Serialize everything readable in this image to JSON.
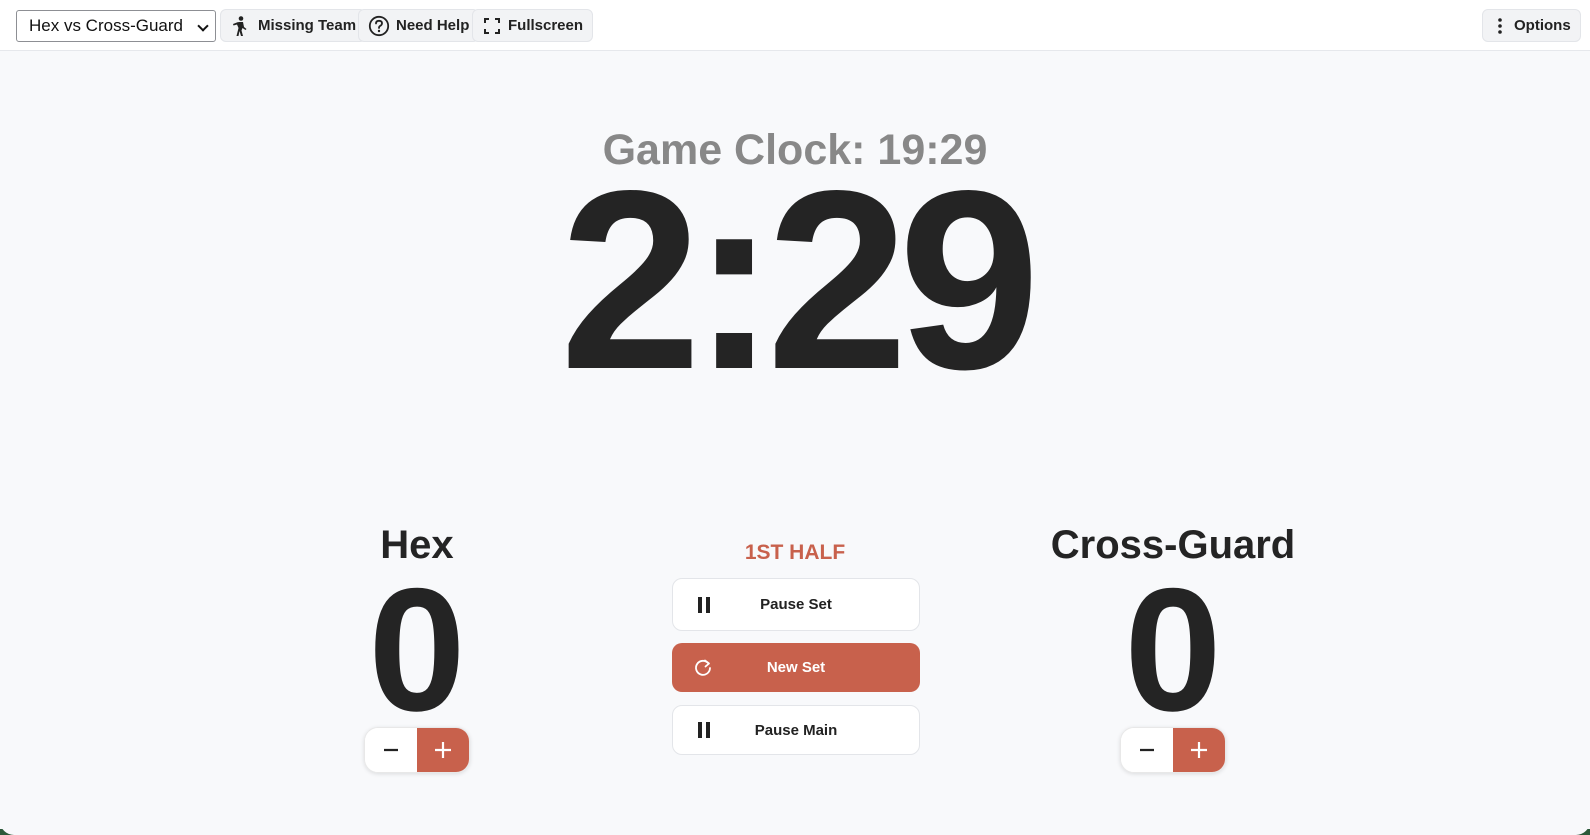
{
  "toolbar": {
    "match_select": {
      "value": "Hex vs Cross-Guard"
    },
    "missing_team_label": "Missing Team",
    "need_help_label": "Need Help",
    "fullscreen_label": "Fullscreen",
    "options_label": "Options"
  },
  "clocks": {
    "game_clock": "Game Clock: 19:29",
    "set_clock": "2:29"
  },
  "teams": {
    "left": {
      "name": "Hex",
      "score": "0"
    },
    "right": {
      "name": "Cross-Guard",
      "score": "0"
    }
  },
  "controls": {
    "half": "1ST HALF",
    "pause_set": "Pause Set",
    "new_set": "New Set",
    "pause_main": "Pause Main"
  },
  "icons": {
    "missing_team": "person-walking-icon",
    "need_help": "question-circle-icon",
    "fullscreen": "fullscreen-icon",
    "options": "vertical-dots-icon",
    "pause": "pause-icon",
    "new_set": "refresh-icon",
    "minus": "minus-icon",
    "plus": "plus-icon"
  },
  "colors": {
    "accent": "#c8614c",
    "text_dark": "#242424",
    "text_muted": "#888888",
    "background": "#f8f9fb"
  }
}
